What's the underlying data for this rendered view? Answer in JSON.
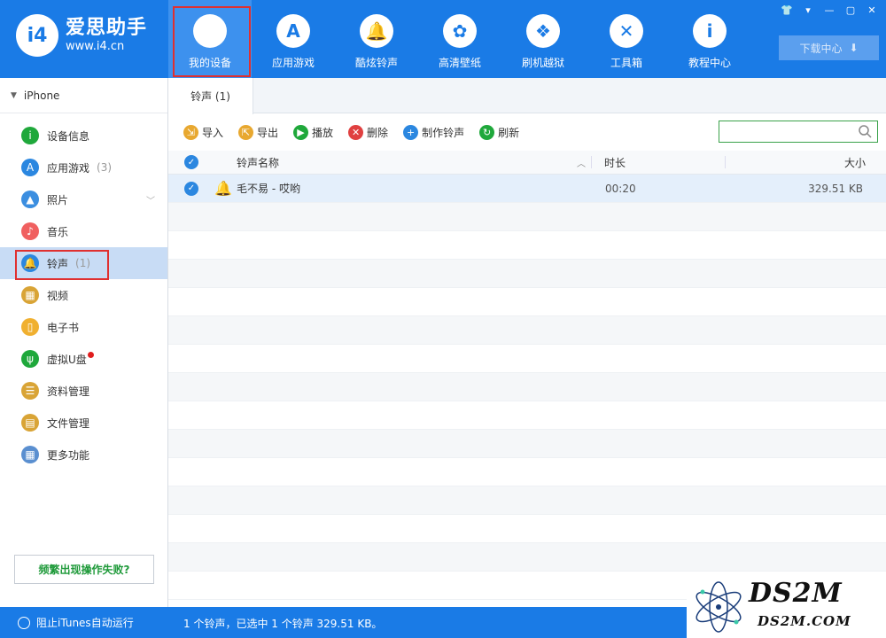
{
  "app": {
    "logo_mark": "i4",
    "name": "爱思助手",
    "url": "www.i4.cn"
  },
  "nav": [
    {
      "label": "我的设备",
      "icon": "apple-icon",
      "glyph": "",
      "active": true
    },
    {
      "label": "应用游戏",
      "icon": "app-store-icon",
      "glyph": "A"
    },
    {
      "label": "酷炫铃声",
      "icon": "bell-icon",
      "glyph": "🔔"
    },
    {
      "label": "高清壁纸",
      "icon": "flower-icon",
      "glyph": "✿"
    },
    {
      "label": "刷机越狱",
      "icon": "dropbox-icon",
      "glyph": "❖"
    },
    {
      "label": "工具箱",
      "icon": "tools-icon",
      "glyph": "✕"
    },
    {
      "label": "教程中心",
      "icon": "info-icon",
      "glyph": "i"
    }
  ],
  "window_controls": [
    "👕",
    "▾",
    "—",
    "▢",
    "✕"
  ],
  "download_center": {
    "label": "下载中心",
    "icon": "⬇"
  },
  "sidebar": {
    "device": "iPhone",
    "items": [
      {
        "label": "设备信息",
        "icon": "info-circle-icon",
        "glyph": "i",
        "color": "#1fa83b"
      },
      {
        "label": "应用游戏",
        "icon": "app-store-icon",
        "glyph": "A",
        "color": "#2b87e0",
        "count": "(3)"
      },
      {
        "label": "照片",
        "icon": "photo-icon",
        "glyph": "▲",
        "color": "#3b8ee0",
        "expand": "﹀"
      },
      {
        "label": "音乐",
        "icon": "music-icon",
        "glyph": "♪",
        "color": "#f06060"
      },
      {
        "label": "铃声",
        "icon": "bell-icon",
        "glyph": "🔔",
        "color": "#2b87e0",
        "count": "(1)",
        "active": true
      },
      {
        "label": "视频",
        "icon": "film-icon",
        "glyph": "▦",
        "color": "#d9a436"
      },
      {
        "label": "电子书",
        "icon": "book-icon",
        "glyph": "▯",
        "color": "#f0b030"
      },
      {
        "label": "虚拟U盘",
        "icon": "usb-icon",
        "glyph": "ψ",
        "color": "#1fa83b",
        "badge": true
      },
      {
        "label": "资料管理",
        "icon": "contacts-icon",
        "glyph": "☰",
        "color": "#d9a436"
      },
      {
        "label": "文件管理",
        "icon": "file-icon",
        "glyph": "▤",
        "color": "#d9a436"
      },
      {
        "label": "更多功能",
        "icon": "grid-icon",
        "glyph": "▦",
        "color": "#5a8fd0"
      }
    ],
    "help_button": "频繁出现操作失败?"
  },
  "tab": {
    "label": "铃声 (1)"
  },
  "toolbar": [
    {
      "label": "导入",
      "icon": "import-icon",
      "glyph": "⇲",
      "color": "#e8a830"
    },
    {
      "label": "导出",
      "icon": "export-icon",
      "glyph": "⇱",
      "color": "#e8a830"
    },
    {
      "label": "播放",
      "icon": "play-icon",
      "glyph": "▶",
      "color": "#1fa83b"
    },
    {
      "label": "删除",
      "icon": "delete-icon",
      "glyph": "✕",
      "color": "#e04040"
    },
    {
      "label": "制作铃声",
      "icon": "make-ringtone-icon",
      "glyph": "+",
      "color": "#2b87e0"
    },
    {
      "label": "刷新",
      "icon": "refresh-icon",
      "glyph": "↻",
      "color": "#1fa83b"
    }
  ],
  "table": {
    "columns": {
      "name": "铃声名称",
      "duration": "时长",
      "size": "大小"
    },
    "rows": [
      {
        "name": "毛不易 - 哎哟",
        "duration": "00:20",
        "size": "329.51 KB",
        "selected": true
      }
    ]
  },
  "status": {
    "itunes_toggle": "阻止iTunes自动运行",
    "summary": "1 个铃声，已选中 1 个铃声 329.51 KB。"
  },
  "watermark": {
    "main": "DS2M",
    "sub": "DS2M.COM"
  }
}
